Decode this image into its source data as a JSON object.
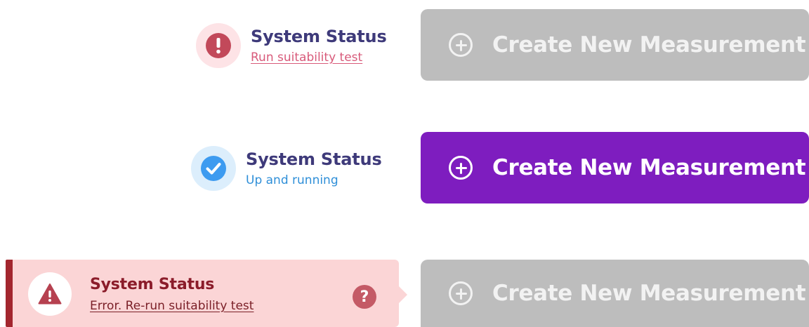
{
  "rows": [
    {
      "state": "warning",
      "status_title": "System Status",
      "status_sub": "Run suitability test",
      "icon": "exclamation-circle-icon",
      "button_label": "Create New Measurement",
      "button_state": "disabled"
    },
    {
      "state": "ok",
      "status_title": "System Status",
      "status_sub": "Up and running",
      "icon": "check-circle-icon",
      "button_label": "Create New Measurement",
      "button_state": "enabled"
    },
    {
      "state": "error",
      "status_title": "System Status",
      "status_sub": "Error. Re-run suitability test",
      "icon": "warning-triangle-icon",
      "help_icon": "question-circle-icon",
      "button_label": "Create New Measurement",
      "button_state": "disabled"
    }
  ],
  "colors": {
    "title": "#3e3a7a",
    "warning_link": "#d85a7a",
    "warning_icon_bg": "#fde3e6",
    "warning_icon": "#c2495a",
    "ok_link": "#2f8fd8",
    "ok_icon_bg": "#dceefc",
    "ok_icon": "#3d9bf0",
    "error_title": "#8b1c2a",
    "error_link": "#7a1f27",
    "error_bg": "#fbd5d6",
    "error_border": "#a3262e",
    "button_active": "#7e1dbf",
    "button_disabled": "#bdbdbd",
    "icon_glyph": "plus-circle-icon"
  }
}
